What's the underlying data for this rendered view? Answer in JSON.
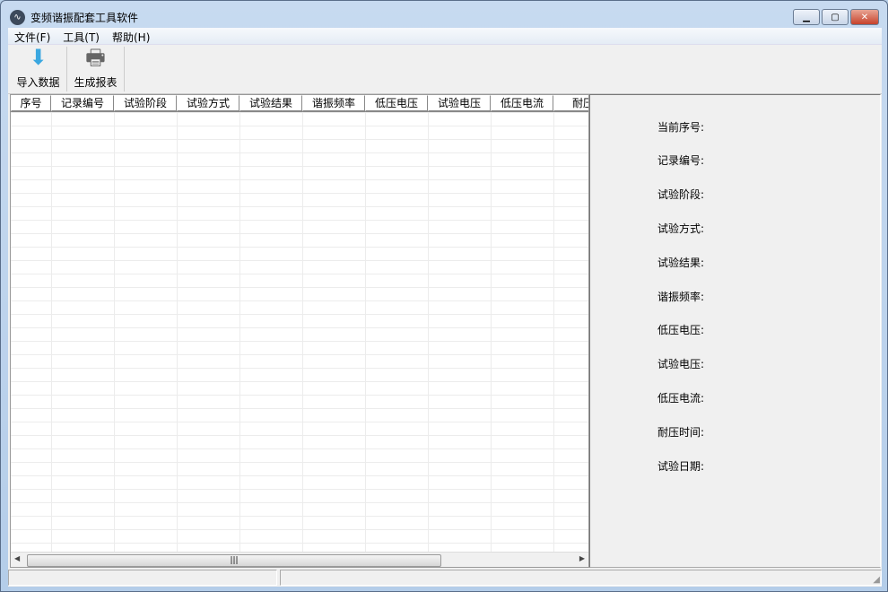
{
  "window": {
    "title": "变频谐振配套工具软件",
    "icon": "waveform-icon"
  },
  "menu": [
    "文件(F)",
    "工具(T)",
    "帮助(H)"
  ],
  "toolbar": [
    {
      "label": "导入数据",
      "icon": "import-icon"
    },
    {
      "label": "生成报表",
      "icon": "printer-icon"
    }
  ],
  "table": {
    "columns": [
      "序号",
      "记录编号",
      "试验阶段",
      "试验方式",
      "试验结果",
      "谐振频率",
      "低压电压",
      "试验电压",
      "低压电流",
      "耐压时间"
    ],
    "rows": []
  },
  "details": {
    "labels": [
      "当前序号:",
      "记录编号:",
      "试验阶段:",
      "试验方式:",
      "试验结果:",
      "谐振频率:",
      "低压电压:",
      "试验电压:",
      "低压电流:",
      "耐压时间:",
      "试验日期:"
    ]
  }
}
